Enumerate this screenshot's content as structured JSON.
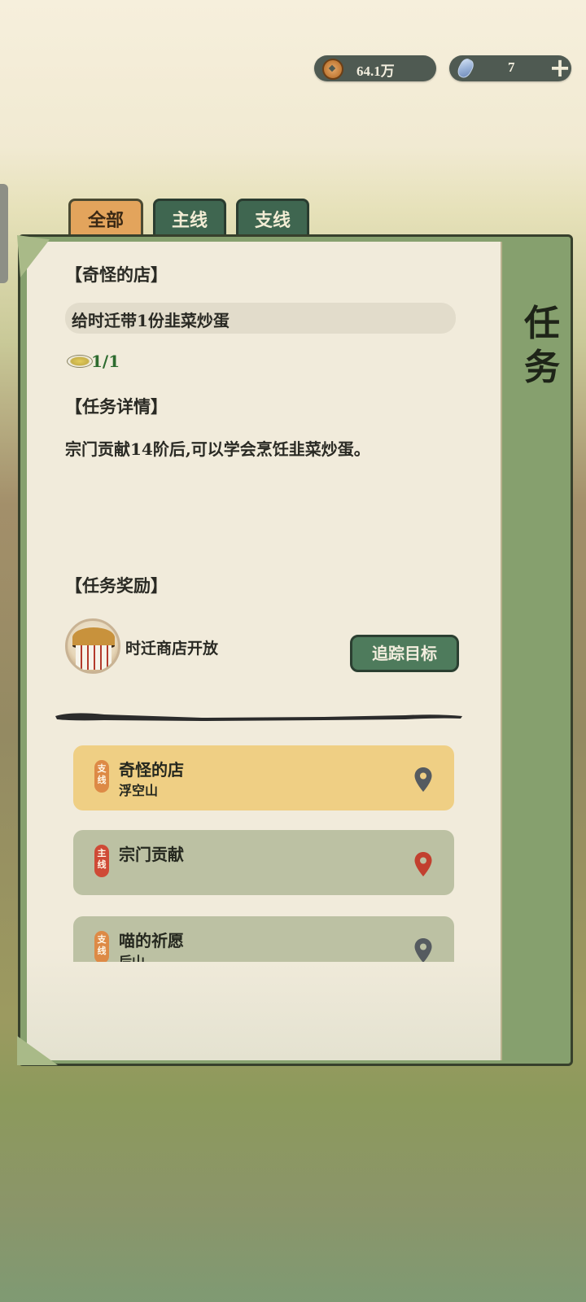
{
  "currency": {
    "coins": "64.1万",
    "gems": "7",
    "add_label": "+"
  },
  "tabs": [
    {
      "label": "全部",
      "active": true
    },
    {
      "label": "主线",
      "active": false
    },
    {
      "label": "支线",
      "active": false
    }
  ],
  "panel": {
    "title": "任务"
  },
  "quest": {
    "name": "【奇怪的店】",
    "objective": "给时迁带1份韭菜炒蛋",
    "progress": "1/1",
    "detail_heading": "【任务详情】",
    "detail": "宗门贡献14阶后,可以学会烹饪韭菜炒蛋。",
    "reward_heading": "【任务奖励】",
    "reward_label": "时迁商店开放",
    "track_button": "追踪目标"
  },
  "quest_list": [
    {
      "type": "支线",
      "title": "奇怪的店",
      "location": "浮空山",
      "active": true
    },
    {
      "type": "主线",
      "title": "宗门贡献",
      "location": "",
      "active": false
    },
    {
      "type": "支线",
      "title": "喵的祈愿",
      "location": "后山",
      "active": false
    }
  ],
  "colors": {
    "side_badge": "#dd8a46",
    "main_badge": "#cf4a36",
    "active_card": "#efcf84",
    "idle_card": "#bcc1a3",
    "pin_dark": "#555b60",
    "pin_red": "#c2402f"
  },
  "icons": {
    "coin": "coin-icon",
    "gem": "gem-icon",
    "pin": "map-pin-icon"
  }
}
